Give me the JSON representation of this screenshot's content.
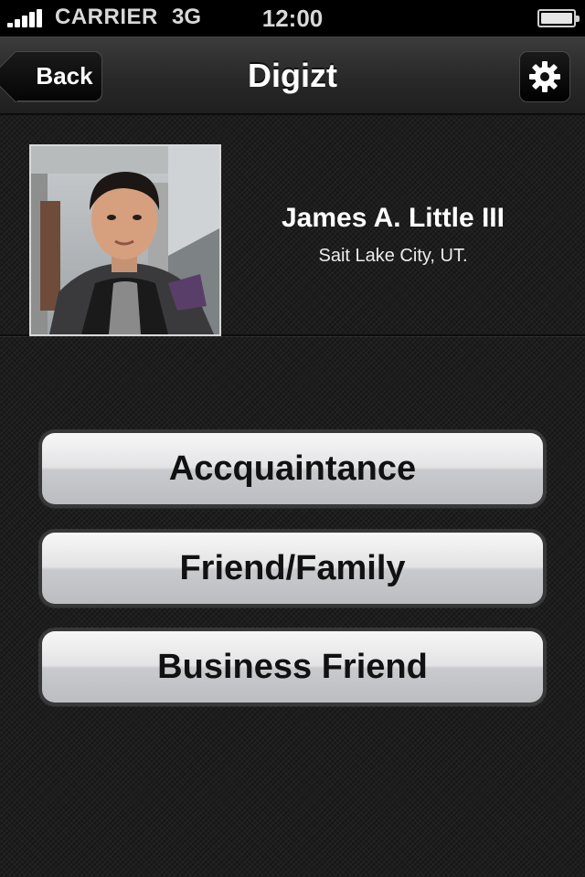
{
  "status_bar": {
    "carrier": "CARRIER",
    "network": "3G",
    "time": "12:00",
    "battery_level": 1.0
  },
  "nav": {
    "back_label": "Back",
    "title": "Digizt",
    "settings_icon": "gear-icon"
  },
  "profile": {
    "name": "James A. Little III",
    "location": "Sait Lake City, UT."
  },
  "relationship_options": [
    {
      "label": "Accquaintance"
    },
    {
      "label": "Friend/Family"
    },
    {
      "label": "Business Friend"
    }
  ],
  "colors": {
    "background": "#1e1e1e",
    "nav_bar": "#2a2a2a",
    "button_face": "#e3e3e5",
    "button_text": "#111111"
  }
}
